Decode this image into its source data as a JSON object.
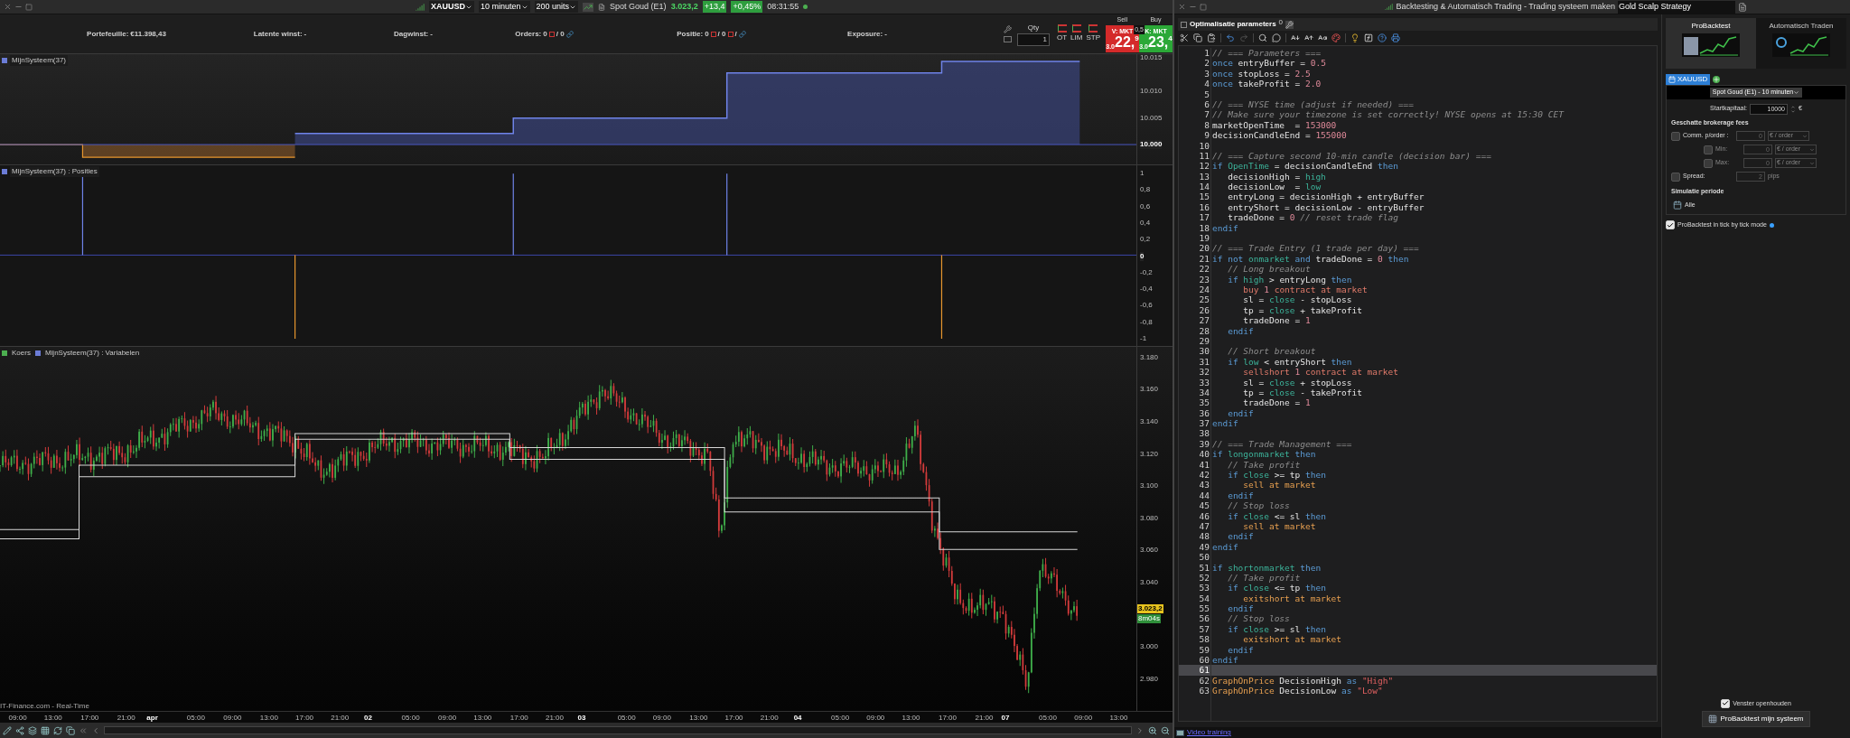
{
  "toolbar": {
    "instrument": "XAUUSD",
    "timeframe": "10 minuten",
    "units": "200 units",
    "quote_name": "Spot Goud (E1)",
    "price": "3.023,2",
    "change": "+13,4",
    "change_pct": "+0,45%",
    "time": "08:31:55"
  },
  "account_bar": [
    {
      "label": "Portefeuille:",
      "values": [
        "€11.398,43"
      ]
    },
    {
      "label": "Latente winst:",
      "values": [
        "-"
      ]
    },
    {
      "label": "Dagwinst:",
      "values": [
        "-"
      ]
    },
    {
      "label": "Orders:",
      "values": [
        "0",
        "/ 0"
      ]
    },
    {
      "label": "Positie:",
      "values": [
        "0",
        "/ 0",
        "/"
      ]
    },
    {
      "label": "Exposure:",
      "values": [
        "-"
      ]
    }
  ],
  "order_ticket": {
    "qty_label": "Qty",
    "qty": "1",
    "order_types": [
      "OT",
      "LIM",
      "STP"
    ],
    "sell_label": "Sell",
    "buy_label": "Buy",
    "spread": "0,5",
    "sell": {
      "label": "V: MKT",
      "prefix": "3.0",
      "big": "22,",
      "small": "9"
    },
    "buy": {
      "label": "K: MKT",
      "prefix": "3.0",
      "big": "23,",
      "small": "4"
    }
  },
  "panels": [
    {
      "kind": "equity",
      "labels": [
        "MijnSysteem(37)"
      ],
      "axis": [
        "10.015",
        "10.010",
        "10.005",
        "10.000"
      ]
    },
    {
      "kind": "positions",
      "labels": [
        "MijnSysteem(37) : Posities"
      ],
      "axis": [
        "1",
        "0,8",
        "0,6",
        "0,4",
        "0,2",
        "0",
        "-0,2",
        "-0,4",
        "-0,6",
        "-0,8",
        "-1"
      ]
    },
    {
      "kind": "price",
      "labels": [
        "Koers",
        "MijnSysteem(37) : Variabelen"
      ],
      "axis": [
        "3.180",
        "3.160",
        "3.140",
        "3.120",
        "3.100",
        "3.080",
        "3.060",
        "3.040",
        "3.000",
        "2.980"
      ],
      "price_tag": "3.023,2",
      "countdown": "8m04s"
    }
  ],
  "time_axis": [
    {
      "label": "09:00",
      "major": false
    },
    {
      "label": "13:00",
      "major": false
    },
    {
      "label": "17:00",
      "major": false
    },
    {
      "label": "21:00",
      "major": false
    },
    {
      "label": "apr",
      "major": true
    },
    {
      "label": "05:00",
      "major": false
    },
    {
      "label": "09:00",
      "major": false
    },
    {
      "label": "13:00",
      "major": false
    },
    {
      "label": "17:00",
      "major": false
    },
    {
      "label": "21:00",
      "major": false
    },
    {
      "label": "02",
      "major": true
    },
    {
      "label": "05:00",
      "major": false
    },
    {
      "label": "09:00",
      "major": false
    },
    {
      "label": "13:00",
      "major": false
    },
    {
      "label": "17:00",
      "major": false
    },
    {
      "label": "21:00",
      "major": false
    },
    {
      "label": "03",
      "major": true
    },
    {
      "label": "05:00",
      "major": false
    },
    {
      "label": "09:00",
      "major": false
    },
    {
      "label": "13:00",
      "major": false
    },
    {
      "label": "17:00",
      "major": false
    },
    {
      "label": "21:00",
      "major": false
    },
    {
      "label": "04",
      "major": true
    },
    {
      "label": "05:00",
      "major": false
    },
    {
      "label": "09:00",
      "major": false
    },
    {
      "label": "13:00",
      "major": false
    },
    {
      "label": "17:00",
      "major": false
    },
    {
      "label": "21:00",
      "major": false
    },
    {
      "label": "07",
      "major": true
    },
    {
      "label": "05:00",
      "major": false
    },
    {
      "label": "09:00",
      "major": false
    },
    {
      "label": "13:00",
      "major": false
    }
  ],
  "data_source": "IT-Finance.com - Real-Time",
  "editor": {
    "window_title": "Backtesting & Automatisch Trading - Trading systeem maken",
    "system_name": "Gold Scalp Strategy",
    "section": "Optimalisatie parameters",
    "param_count": "0",
    "footer_link": "Video training",
    "lines": [
      {
        "number": "1",
        "current": false,
        "tokens": [
          {
            "kind": "comment",
            "text": "// === Parameters ==="
          }
        ]
      },
      {
        "number": "2",
        "current": false,
        "tokens": [
          {
            "kind": "keyword",
            "text": "once"
          },
          {
            "kind": "plain",
            "text": " entryBuffer = "
          },
          {
            "kind": "number",
            "text": "0.5"
          }
        ]
      },
      {
        "number": "3",
        "current": false,
        "tokens": [
          {
            "kind": "keyword",
            "text": "once"
          },
          {
            "kind": "plain",
            "text": " stopLoss = "
          },
          {
            "kind": "number",
            "text": "2.5"
          }
        ]
      },
      {
        "number": "4",
        "current": false,
        "tokens": [
          {
            "kind": "keyword",
            "text": "once"
          },
          {
            "kind": "plain",
            "text": " takeProfit = "
          },
          {
            "kind": "number",
            "text": "2.0"
          }
        ]
      },
      {
        "number": "5",
        "current": false
      },
      {
        "number": "6",
        "current": false,
        "tokens": [
          {
            "kind": "comment",
            "text": "// === NYSE time (adjust if needed) ==="
          }
        ]
      },
      {
        "number": "7",
        "current": false,
        "tokens": [
          {
            "kind": "comment",
            "text": "// Make sure your timezone is set correctly! NYSE opens at 15:30 CET"
          }
        ]
      },
      {
        "number": "8",
        "current": false,
        "tokens": [
          {
            "kind": "plain",
            "text": "marketOpenTime  = "
          },
          {
            "kind": "number",
            "text": "153000"
          }
        ]
      },
      {
        "number": "9",
        "current": false,
        "tokens": [
          {
            "kind": "plain",
            "text": "decisionCandleEnd = "
          },
          {
            "kind": "number",
            "text": "155000"
          }
        ]
      },
      {
        "number": "10",
        "current": false
      },
      {
        "number": "11",
        "current": false,
        "tokens": [
          {
            "kind": "comment",
            "text": "// === Capture second 10-min candle (decision bar) ==="
          }
        ]
      },
      {
        "number": "12",
        "current": false,
        "tokens": [
          {
            "kind": "keyword",
            "text": "if "
          },
          {
            "kind": "builtin",
            "text": "OpenTime"
          },
          {
            "kind": "plain",
            "text": " = decisionCandleEnd "
          },
          {
            "kind": "keyword",
            "text": "then"
          }
        ]
      },
      {
        "number": "13",
        "current": false,
        "tokens": [
          {
            "kind": "plain",
            "text": "   decisionHigh = "
          },
          {
            "kind": "builtin",
            "text": "high"
          }
        ]
      },
      {
        "number": "14",
        "current": false,
        "tokens": [
          {
            "kind": "plain",
            "text": "   decisionLow  = "
          },
          {
            "kind": "builtin",
            "text": "low"
          }
        ]
      },
      {
        "number": "15",
        "current": false,
        "tokens": [
          {
            "kind": "plain",
            "text": "   entryLong = decisionHigh + entryBuffer"
          }
        ]
      },
      {
        "number": "16",
        "current": false,
        "tokens": [
          {
            "kind": "plain",
            "text": "   entryShort = decisionLow - entryBuffer"
          }
        ]
      },
      {
        "number": "17",
        "current": false,
        "tokens": [
          {
            "kind": "plain",
            "text": "   tradeDone = "
          },
          {
            "kind": "number",
            "text": "0"
          },
          {
            "kind": "comment",
            "text": " // reset trade flag"
          }
        ]
      },
      {
        "number": "18",
        "current": false,
        "tokens": [
          {
            "kind": "keyword",
            "text": "endif"
          }
        ]
      },
      {
        "number": "19",
        "current": false
      },
      {
        "number": "20",
        "current": false,
        "tokens": [
          {
            "kind": "comment",
            "text": "// === Trade Entry (1 trade per day) ==="
          }
        ]
      },
      {
        "number": "21",
        "current": false,
        "tokens": [
          {
            "kind": "keyword",
            "text": "if not "
          },
          {
            "kind": "builtin",
            "text": "onmarket"
          },
          {
            "kind": "keyword",
            "text": " and"
          },
          {
            "kind": "plain",
            "text": " tradeDone = "
          },
          {
            "kind": "number",
            "text": "0"
          },
          {
            "kind": "keyword",
            "text": " then"
          }
        ]
      },
      {
        "number": "22",
        "current": false,
        "tokens": [
          {
            "kind": "comment",
            "text": "   // Long breakout"
          }
        ]
      },
      {
        "number": "23",
        "current": false,
        "tokens": [
          {
            "kind": "keyword",
            "text": "   if "
          },
          {
            "kind": "builtin",
            "text": "high"
          },
          {
            "kind": "plain",
            "text": " > entryLong "
          },
          {
            "kind": "keyword",
            "text": "then"
          }
        ]
      },
      {
        "number": "24",
        "current": false,
        "tokens": [
          {
            "kind": "order",
            "text": "      buy "
          },
          {
            "kind": "number",
            "text": "1"
          },
          {
            "kind": "order",
            "text": " contract at market"
          }
        ]
      },
      {
        "number": "25",
        "current": false,
        "tokens": [
          {
            "kind": "plain",
            "text": "      sl = "
          },
          {
            "kind": "builtin",
            "text": "close"
          },
          {
            "kind": "plain",
            "text": " - stopLoss"
          }
        ]
      },
      {
        "number": "26",
        "current": false,
        "tokens": [
          {
            "kind": "plain",
            "text": "      tp = "
          },
          {
            "kind": "builtin",
            "text": "close"
          },
          {
            "kind": "plain",
            "text": " + takeProfit"
          }
        ]
      },
      {
        "number": "27",
        "current": false,
        "tokens": [
          {
            "kind": "plain",
            "text": "      tradeDone = "
          },
          {
            "kind": "number",
            "text": "1"
          }
        ]
      },
      {
        "number": "28",
        "current": false,
        "tokens": [
          {
            "kind": "keyword",
            "text": "   endif"
          }
        ]
      },
      {
        "number": "29",
        "current": false
      },
      {
        "number": "30",
        "current": false,
        "tokens": [
          {
            "kind": "comment",
            "text": "   // Short breakout"
          }
        ]
      },
      {
        "number": "31",
        "current": false,
        "tokens": [
          {
            "kind": "keyword",
            "text": "   if "
          },
          {
            "kind": "builtin",
            "text": "low"
          },
          {
            "kind": "plain",
            "text": " < entryShort "
          },
          {
            "kind": "keyword",
            "text": "then"
          }
        ]
      },
      {
        "number": "32",
        "current": false,
        "tokens": [
          {
            "kind": "order",
            "text": "      sellshort "
          },
          {
            "kind": "number",
            "text": "1"
          },
          {
            "kind": "order",
            "text": " contract at market"
          }
        ]
      },
      {
        "number": "33",
        "current": false,
        "tokens": [
          {
            "kind": "plain",
            "text": "      sl = "
          },
          {
            "kind": "builtin",
            "text": "close"
          },
          {
            "kind": "plain",
            "text": " + stopLoss"
          }
        ]
      },
      {
        "number": "34",
        "current": false,
        "tokens": [
          {
            "kind": "plain",
            "text": "      tp = "
          },
          {
            "kind": "builtin",
            "text": "close"
          },
          {
            "kind": "plain",
            "text": " - takeProfit"
          }
        ]
      },
      {
        "number": "35",
        "current": false,
        "tokens": [
          {
            "kind": "plain",
            "text": "      tradeDone = "
          },
          {
            "kind": "number",
            "text": "1"
          }
        ]
      },
      {
        "number": "36",
        "current": false,
        "tokens": [
          {
            "kind": "keyword",
            "text": "   endif"
          }
        ]
      },
      {
        "number": "37",
        "current": false,
        "tokens": [
          {
            "kind": "keyword",
            "text": "endif"
          }
        ]
      },
      {
        "number": "38",
        "current": false
      },
      {
        "number": "39",
        "current": false,
        "tokens": [
          {
            "kind": "comment",
            "text": "// === Trade Management ==="
          }
        ]
      },
      {
        "number": "40",
        "current": false,
        "tokens": [
          {
            "kind": "keyword",
            "text": "if "
          },
          {
            "kind": "builtin",
            "text": "longonmarket"
          },
          {
            "kind": "keyword",
            "text": " then"
          }
        ]
      },
      {
        "number": "41",
        "current": false,
        "tokens": [
          {
            "kind": "comment",
            "text": "   // Take profit"
          }
        ]
      },
      {
        "number": "42",
        "current": false,
        "tokens": [
          {
            "kind": "keyword",
            "text": "   if "
          },
          {
            "kind": "builtin",
            "text": "close"
          },
          {
            "kind": "plain",
            "text": " >= tp "
          },
          {
            "kind": "keyword",
            "text": "then"
          }
        ]
      },
      {
        "number": "43",
        "current": false,
        "tokens": [
          {
            "kind": "action",
            "text": "      sell at market"
          }
        ]
      },
      {
        "number": "44",
        "current": false,
        "tokens": [
          {
            "kind": "keyword",
            "text": "   endif"
          }
        ]
      },
      {
        "number": "45",
        "current": false,
        "tokens": [
          {
            "kind": "comment",
            "text": "   // Stop loss"
          }
        ]
      },
      {
        "number": "46",
        "current": false,
        "tokens": [
          {
            "kind": "keyword",
            "text": "   if "
          },
          {
            "kind": "builtin",
            "text": "close"
          },
          {
            "kind": "plain",
            "text": " <= sl "
          },
          {
            "kind": "keyword",
            "text": "then"
          }
        ]
      },
      {
        "number": "47",
        "current": false,
        "tokens": [
          {
            "kind": "action",
            "text": "      sell at market"
          }
        ]
      },
      {
        "number": "48",
        "current": false,
        "tokens": [
          {
            "kind": "keyword",
            "text": "   endif"
          }
        ]
      },
      {
        "number": "49",
        "current": false,
        "tokens": [
          {
            "kind": "keyword",
            "text": "endif"
          }
        ]
      },
      {
        "number": "50",
        "current": false
      },
      {
        "number": "51",
        "current": false,
        "tokens": [
          {
            "kind": "keyword",
            "text": "if "
          },
          {
            "kind": "builtin",
            "text": "shortonmarket"
          },
          {
            "kind": "keyword",
            "text": " then"
          }
        ]
      },
      {
        "number": "52",
        "current": false,
        "tokens": [
          {
            "kind": "comment",
            "text": "   // Take profit"
          }
        ]
      },
      {
        "number": "53",
        "current": false,
        "tokens": [
          {
            "kind": "keyword",
            "text": "   if "
          },
          {
            "kind": "builtin",
            "text": "close"
          },
          {
            "kind": "plain",
            "text": " <= tp "
          },
          {
            "kind": "keyword",
            "text": "then"
          }
        ]
      },
      {
        "number": "54",
        "current": false,
        "tokens": [
          {
            "kind": "action",
            "text": "      exitshort at market"
          }
        ]
      },
      {
        "number": "55",
        "current": false,
        "tokens": [
          {
            "kind": "keyword",
            "text": "   endif"
          }
        ]
      },
      {
        "number": "56",
        "current": false,
        "tokens": [
          {
            "kind": "comment",
            "text": "   // Stop loss"
          }
        ]
      },
      {
        "number": "57",
        "current": false,
        "tokens": [
          {
            "kind": "keyword",
            "text": "   if "
          },
          {
            "kind": "builtin",
            "text": "close"
          },
          {
            "kind": "plain",
            "text": " >= sl "
          },
          {
            "kind": "keyword",
            "text": "then"
          }
        ]
      },
      {
        "number": "58",
        "current": false,
        "tokens": [
          {
            "kind": "action",
            "text": "      exitshort at market"
          }
        ]
      },
      {
        "number": "59",
        "current": false,
        "tokens": [
          {
            "kind": "keyword",
            "text": "   endif"
          }
        ]
      },
      {
        "number": "60",
        "current": false,
        "tokens": [
          {
            "kind": "keyword",
            "text": "endif"
          }
        ]
      },
      {
        "number": "61",
        "current": true
      },
      {
        "number": "62",
        "current": false,
        "tokens": [
          {
            "kind": "action",
            "text": "GraphOnPrice"
          },
          {
            "kind": "plain",
            "text": " DecisionHigh "
          },
          {
            "kind": "keyword",
            "text": "as"
          },
          {
            "kind": "string",
            "text": " \"High\""
          }
        ]
      },
      {
        "number": "63",
        "current": false,
        "tokens": [
          {
            "kind": "action",
            "text": "GraphOnPrice"
          },
          {
            "kind": "plain",
            "text": " DecisionLow "
          },
          {
            "kind": "keyword",
            "text": "as"
          },
          {
            "kind": "string",
            "text": " \"Low\""
          }
        ]
      }
    ]
  },
  "backtest_panel": {
    "tabs": [
      {
        "label": "ProBacktest",
        "selected": true
      },
      {
        "label": "Automatisch Traden",
        "selected": false
      }
    ],
    "instrument_tab": "XAUUSD",
    "instrument_select": "Spot Goud (E1) - 10 minuten",
    "start_capital": {
      "label": "Startkapitaal:",
      "value": "10000",
      "unit": "€"
    },
    "fees_title": "Geschatte brokerage fees",
    "fees": [
      {
        "kind": "main",
        "label": "Comm. p/order :",
        "value": "0",
        "unit": "€ / order",
        "checked": false
      },
      {
        "kind": "sub",
        "label": "Min:",
        "value": "0",
        "unit": "€ / order",
        "checked": false
      },
      {
        "kind": "sub",
        "label": "Max:",
        "value": "0",
        "unit": "€ / order",
        "checked": false
      },
      {
        "kind": "spread",
        "label": "Spread:",
        "value": "2",
        "unit": "pips",
        "checked": false
      }
    ],
    "period_title": "Simulatie periode",
    "period": "Alle",
    "tick_mode": {
      "label": "ProBacktest in tick by tick mode",
      "checked": true
    },
    "keep_open": {
      "label": "Venster openhouden",
      "checked": true
    },
    "run_button": "ProBacktest mijn systeem"
  }
}
